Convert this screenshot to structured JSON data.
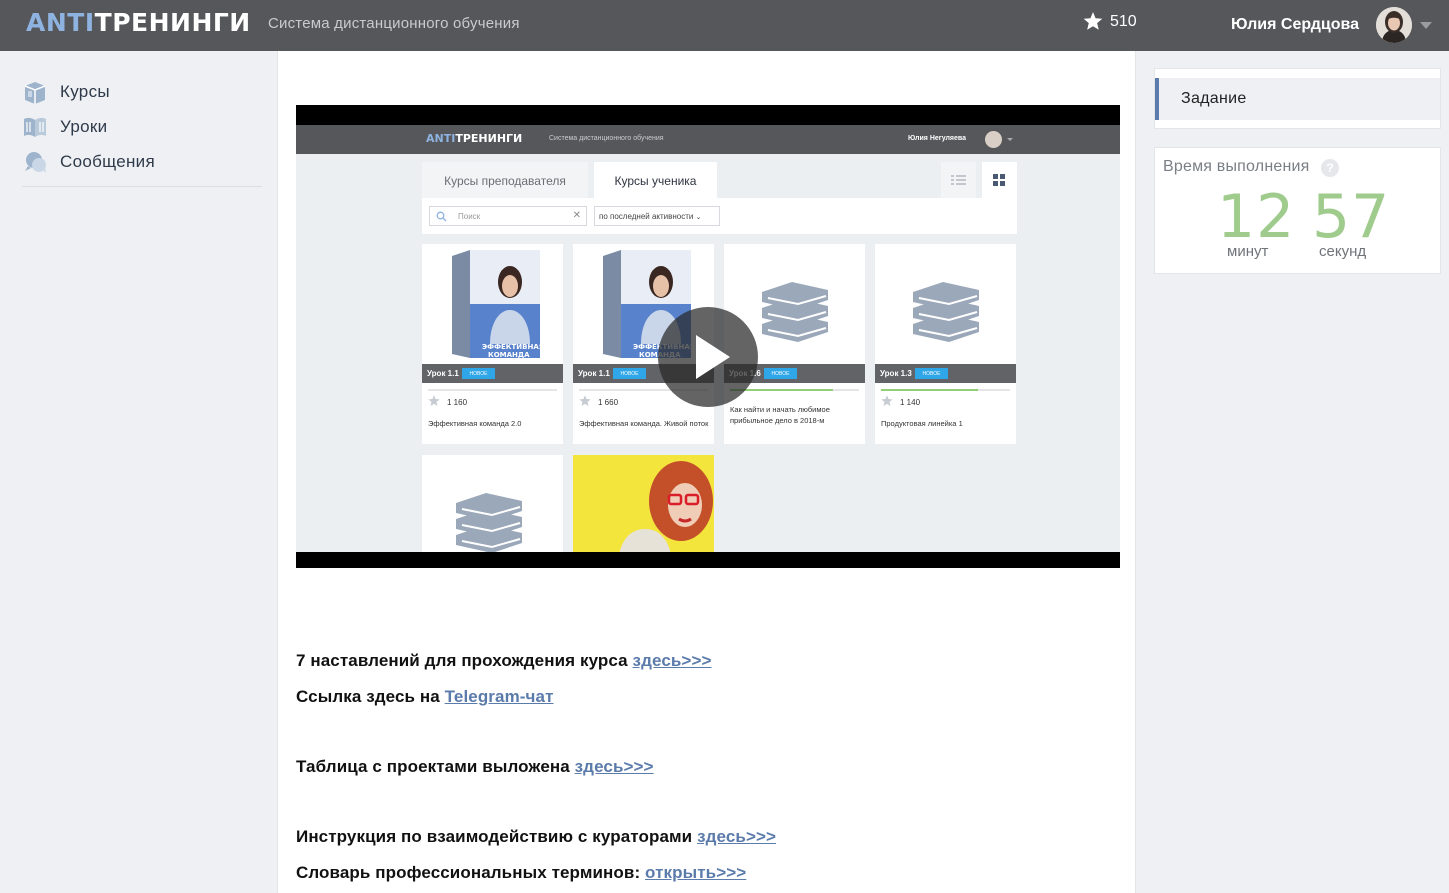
{
  "header": {
    "logo_part1": "ANTI",
    "logo_part2": "ТРЕНИНГИ",
    "tagline": "Система дистанционного обучения",
    "score": "510",
    "user_name": "Юлия Сердцова"
  },
  "sidebar": {
    "items": [
      {
        "label": "Курсы",
        "icon": "courses-icon"
      },
      {
        "label": "Уроки",
        "icon": "lessons-icon"
      },
      {
        "label": "Сообщения",
        "icon": "messages-icon"
      }
    ]
  },
  "video": {
    "logo_part1": "ANTI",
    "logo_part2": "ТРЕНИНГИ",
    "tagline": "Система дистанционного обучения",
    "user_name": "Юлия Негуляева",
    "tabs": [
      "Курсы преподавателя",
      "Курсы ученика"
    ],
    "search_placeholder": "Поиск",
    "sort_select": "по последней активности",
    "cards": [
      {
        "lesson": "Урок 1.1",
        "badge": "НОВОЕ",
        "count": "1 160",
        "title": "Эффективная команда 2.0",
        "progress": 0
      },
      {
        "lesson": "Урок 1.1",
        "badge": "НОВОЕ",
        "count": "1 660",
        "title": "Эффективная команда. Живой поток",
        "progress": 0
      },
      {
        "lesson": "Урок 1.6",
        "badge": "НОВОЕ",
        "count": "",
        "title": "Как найти и начать любимое прибыльное дело в 2018-м",
        "progress": 0.8
      },
      {
        "lesson": "Урок 1.3",
        "badge": "НОВОЕ",
        "count": "1 140",
        "title": "Продуктовая линейка 1",
        "progress": 0.75
      }
    ],
    "cover_text": "ЭФФЕКТИВНАЯ КОМАНДА"
  },
  "content": {
    "lines": [
      {
        "text": "7 наставлений для прохождения курса ",
        "link": "здесь>>>"
      },
      {
        "text": "Ссылка здесь на ",
        "link": "Telegram-чат"
      },
      {
        "text": "Таблица с проектами выложена ",
        "link": "здесь>>>"
      },
      {
        "text": "Инструкция по взаимодействию с кураторами ",
        "link": "здесь>>>"
      },
      {
        "text": "Словарь профессиональных терминов: ",
        "link": "открыть>>>"
      }
    ]
  },
  "right": {
    "task_label": "Задание",
    "timer_title": "Время выполнения",
    "help": "?",
    "minutes": "12",
    "minutes_label": "минут",
    "seconds": "57",
    "seconds_label": "секунд"
  },
  "colors": {
    "header_bg": "#55575b",
    "accent_link": "#5b7bab",
    "timer_green": "#9fcb8c",
    "logo_blue": "#8fb3e0"
  }
}
